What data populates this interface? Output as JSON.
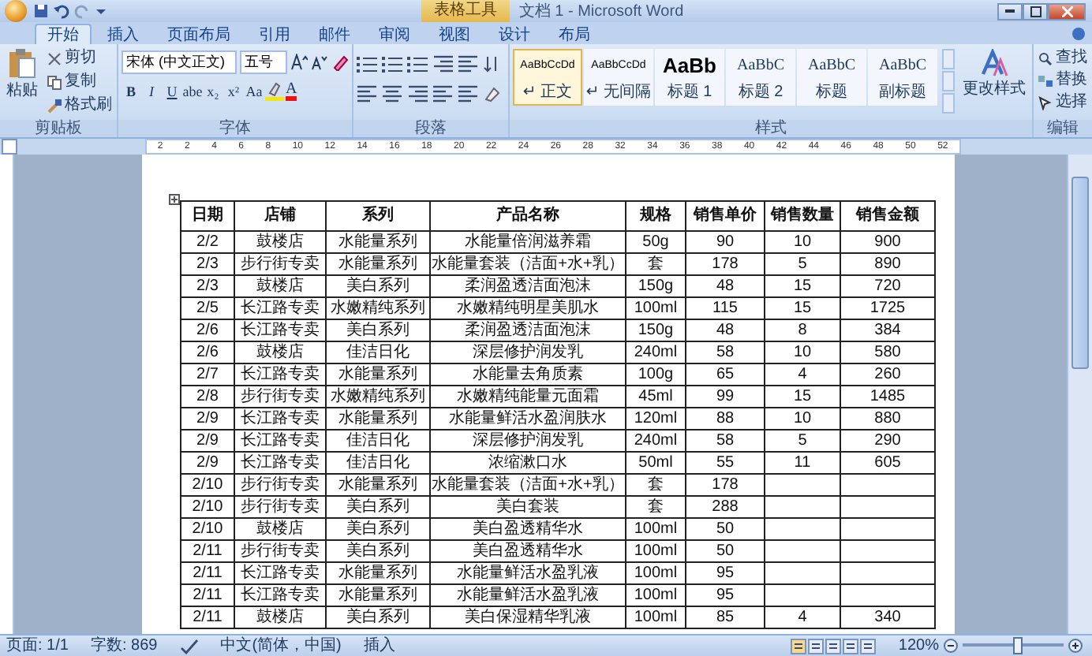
{
  "title_bar": {
    "context_tab": "表格工具",
    "title": "文档 1 - Microsoft Word"
  },
  "tabs": [
    {
      "label": "开始",
      "selected": true
    },
    {
      "label": "插入",
      "selected": false
    },
    {
      "label": "页面布局",
      "selected": false
    },
    {
      "label": "引用",
      "selected": false
    },
    {
      "label": "邮件",
      "selected": false
    },
    {
      "label": "审阅",
      "selected": false
    },
    {
      "label": "视图",
      "selected": false
    },
    {
      "label": "设计",
      "selected": false
    },
    {
      "label": "布局",
      "selected": false
    }
  ],
  "ribbon": {
    "clipboard": {
      "label": "剪贴板",
      "paste": "粘贴",
      "items": [
        "剪切",
        "复制",
        "格式刷"
      ]
    },
    "font": {
      "label": "字体",
      "font_name": "宋体 (中文正文)",
      "font_size": "五号",
      "format_buttons": [
        "B",
        "I",
        "U",
        "abe",
        "x₂",
        "x²",
        "Aa"
      ],
      "color_button": "A"
    },
    "paragraph": {
      "label": "段落"
    },
    "styles": {
      "label": "样式",
      "gallery": [
        {
          "preview": "AaBbCcDd",
          "name": "↵ 正文",
          "kind": "body",
          "selected": true
        },
        {
          "preview": "AaBbCcDd",
          "name": "↵ 无间隔",
          "kind": "body",
          "selected": false
        },
        {
          "preview": "AaBb",
          "name": "标题 1",
          "kind": "heading1",
          "selected": false
        },
        {
          "preview": "AaBbC",
          "name": "标题 2",
          "kind": "heading",
          "selected": false
        },
        {
          "preview": "AaBbC",
          "name": "标题",
          "kind": "heading",
          "selected": false
        },
        {
          "preview": "AaBbC",
          "name": "副标题",
          "kind": "heading",
          "selected": false
        }
      ],
      "change_styles": "更改样式"
    },
    "editing": {
      "label": "编辑",
      "items": [
        "查找",
        "替换",
        "选择"
      ]
    }
  },
  "ruler": {
    "numbers": [
      "2",
      "2",
      "4",
      "6",
      "8",
      "10",
      "12",
      "14",
      "16",
      "18",
      "20",
      "22",
      "24",
      "26",
      "28",
      "32",
      "34",
      "36",
      "38",
      "40",
      "42",
      "44",
      "46",
      "48",
      "50",
      "52"
    ]
  },
  "table": {
    "columns": [
      "日期",
      "店铺",
      "系列",
      "产品名称",
      "规格",
      "销售单价",
      "销售数量",
      "销售金额"
    ],
    "rows": [
      [
        "2/2",
        "鼓楼店",
        "水能量系列",
        "水能量倍润滋养霜",
        "50g",
        "90",
        "10",
        "900"
      ],
      [
        "2/3",
        "步行街专卖",
        "水能量系列",
        "水能量套装（洁面+水+乳）",
        "套",
        "178",
        "5",
        "890"
      ],
      [
        "2/3",
        "鼓楼店",
        "美白系列",
        "柔润盈透洁面泡沫",
        "150g",
        "48",
        "15",
        "720"
      ],
      [
        "2/5",
        "长江路专卖",
        "水嫩精纯系列",
        "水嫩精纯明星美肌水",
        "100ml",
        "115",
        "15",
        "1725"
      ],
      [
        "2/6",
        "长江路专卖",
        "美白系列",
        "柔润盈透洁面泡沫",
        "150g",
        "48",
        "8",
        "384"
      ],
      [
        "2/6",
        "鼓楼店",
        "佳洁日化",
        "深层修护润发乳",
        "240ml",
        "58",
        "10",
        "580"
      ],
      [
        "2/7",
        "长江路专卖",
        "水能量系列",
        "水能量去角质素",
        "100g",
        "65",
        "4",
        "260"
      ],
      [
        "2/8",
        "步行街专卖",
        "水嫩精纯系列",
        "水嫩精纯能量元面霜",
        "45ml",
        "99",
        "15",
        "1485"
      ],
      [
        "2/9",
        "长江路专卖",
        "水能量系列",
        "水能量鲜活水盈润肤水",
        "120ml",
        "88",
        "10",
        "880"
      ],
      [
        "2/9",
        "长江路专卖",
        "佳洁日化",
        "深层修护润发乳",
        "240ml",
        "58",
        "5",
        "290"
      ],
      [
        "2/9",
        "长江路专卖",
        "佳洁日化",
        "浓缩漱口水",
        "50ml",
        "55",
        "11",
        "605"
      ],
      [
        "2/10",
        "步行街专卖",
        "水能量系列",
        "水能量套装（洁面+水+乳）",
        "套",
        "178"
      ],
      [
        "2/10",
        "步行街专卖",
        "美白系列",
        "美白套装",
        "套",
        "288"
      ],
      [
        "2/10",
        "鼓楼店",
        "美白系列",
        "美白盈透精华水",
        "100ml",
        "50"
      ],
      [
        "2/11",
        "步行街专卖",
        "美白系列",
        "美白盈透精华水",
        "100ml",
        "50"
      ],
      [
        "2/11",
        "长江路专卖",
        "水能量系列",
        "水能量鲜活水盈乳液",
        "100ml",
        "95"
      ],
      [
        "2/11",
        "长江路专卖",
        "水能量系列",
        "水能量鲜活水盈乳液",
        "100ml",
        "95"
      ],
      [
        "2/11",
        "鼓楼店",
        "美白系列",
        "美白保湿精华乳液",
        "100ml",
        "85",
        "4",
        "340"
      ]
    ]
  },
  "status_bar": {
    "page": "页面: 1/1",
    "words": "字数: 869",
    "language": "中文(简体，中国)",
    "mode": "插入",
    "zoom": "120%",
    "zoom_slider": {
      "level": 0.55
    }
  }
}
